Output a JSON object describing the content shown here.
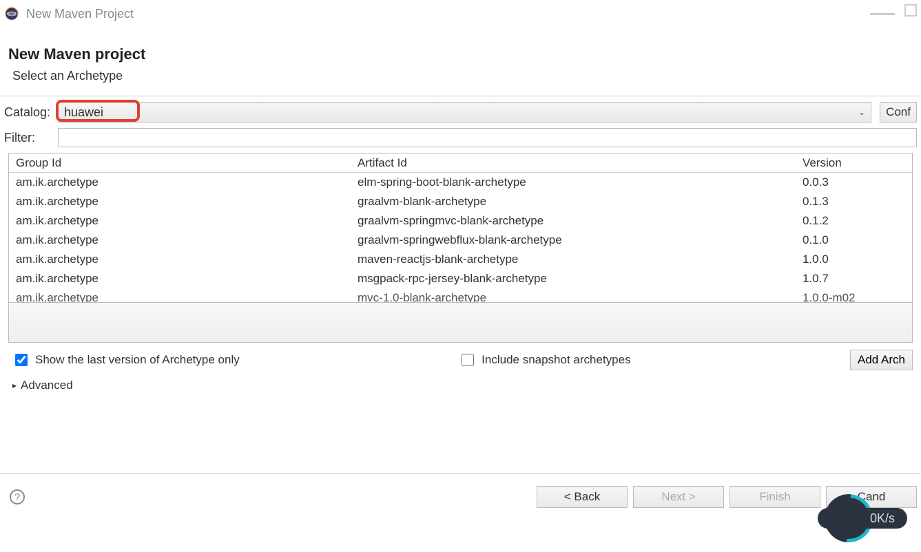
{
  "window": {
    "title": "New Maven Project"
  },
  "header": {
    "heading": "New Maven project",
    "subtitle": "Select an Archetype"
  },
  "catalog": {
    "label": "Catalog:",
    "value": "huawei",
    "configure_btn": "Conf"
  },
  "filter": {
    "label": "Filter:",
    "value": ""
  },
  "table": {
    "columns": {
      "group": "Group Id",
      "artifact": "Artifact Id",
      "version": "Version"
    },
    "rows": [
      {
        "group": "am.ik.archetype",
        "artifact": "elm-spring-boot-blank-archetype",
        "version": "0.0.3"
      },
      {
        "group": "am.ik.archetype",
        "artifact": "graalvm-blank-archetype",
        "version": "0.1.3"
      },
      {
        "group": "am.ik.archetype",
        "artifact": "graalvm-springmvc-blank-archetype",
        "version": "0.1.2"
      },
      {
        "group": "am.ik.archetype",
        "artifact": "graalvm-springwebflux-blank-archetype",
        "version": "0.1.0"
      },
      {
        "group": "am.ik.archetype",
        "artifact": "maven-reactjs-blank-archetype",
        "version": "1.0.0"
      },
      {
        "group": "am.ik.archetype",
        "artifact": "msgpack-rpc-jersey-blank-archetype",
        "version": "1.0.7"
      },
      {
        "group": "am.ik.archetype",
        "artifact": "mvc-1.0-blank-archetype",
        "version": "1.0.0-m02"
      }
    ]
  },
  "options": {
    "show_last": "Show the last version of Archetype only",
    "include_snapshot": "Include snapshot archetypes",
    "add_archetype": "Add Arch"
  },
  "advanced": {
    "label": "Advanced"
  },
  "buttons": {
    "back": "< Back",
    "next": "Next >",
    "finish": "Finish",
    "cancel": "Cand"
  },
  "decor": {
    "speed": "0K/s"
  }
}
